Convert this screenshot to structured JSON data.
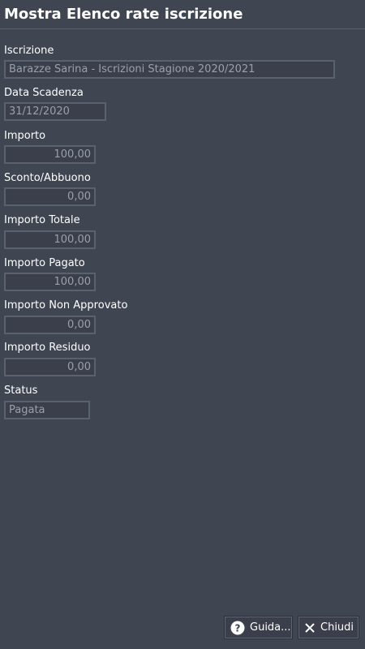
{
  "header": {
    "title": "Mostra Elenco rate iscrizione"
  },
  "fields": {
    "iscrizione": {
      "label": "Iscrizione",
      "value": "Barazze Sarina - Iscrizioni Stagione 2020/2021"
    },
    "data_scadenza": {
      "label": "Data Scadenza",
      "value": "31/12/2020"
    },
    "importo": {
      "label": "Importo",
      "value": "100,00"
    },
    "sconto": {
      "label": "Sconto/Abbuono",
      "value": "0,00"
    },
    "importo_totale": {
      "label": "Importo Totale",
      "value": "100,00"
    },
    "importo_pagato": {
      "label": "Importo Pagato",
      "value": "100,00"
    },
    "importo_non_approvato": {
      "label": "Importo Non Approvato",
      "value": "0,00"
    },
    "importo_residuo": {
      "label": "Importo Residuo",
      "value": "0,00"
    },
    "status": {
      "label": "Status",
      "value": "Pagata"
    }
  },
  "footer": {
    "help_label": "Guida...",
    "close_label": "Chiudi"
  },
  "colors": {
    "background": "#3f4551",
    "input_background": "#3a3f4b",
    "input_border": "#5c626d",
    "input_text": "#9aa0aa"
  },
  "icons": {
    "help": "question-circle-icon",
    "close": "close-x-icon"
  }
}
